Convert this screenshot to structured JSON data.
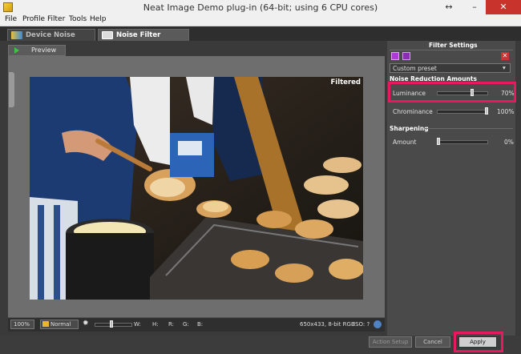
{
  "window": {
    "title": "Neat Image Demo plug-in (64-bit; using 6 CPU cores)",
    "resize_glyph": "↔",
    "minimize": "–",
    "maximize": "□",
    "close": "✕"
  },
  "menu": [
    "File",
    "Profile",
    "Filter",
    "Tools",
    "Help"
  ],
  "tabs": [
    {
      "label": "Device Noise Profile",
      "active": false
    },
    {
      "label": "Noise Filter Settings",
      "active": true
    }
  ],
  "preview": {
    "tab_label": "Preview",
    "overlay_label": "Filtered"
  },
  "status_bar": {
    "zoom": "100%",
    "mode": "Normal",
    "w_label": "W:",
    "h_label": "H:",
    "r_label": "R:",
    "g_label": "G:",
    "b_label": "B:",
    "image_info": "650x433, 8-bit RGB",
    "iso": "ISO: ?"
  },
  "filter_settings": {
    "title": "Filter Settings",
    "preset": "Custom preset",
    "noise_reduction_title": "Noise Reduction Amounts",
    "luminance": {
      "label": "Luminance",
      "value_text": "70%",
      "value": 70
    },
    "chrominance": {
      "label": "Chrominance",
      "value_text": "100%",
      "value": 100
    },
    "sharpening_title": "Sharpening",
    "amount": {
      "label": "Amount",
      "value_text": "0%",
      "value": 0
    }
  },
  "footer": {
    "action_setup": "Action Setup",
    "cancel": "Cancel",
    "apply": "Apply"
  },
  "colors": {
    "highlight": "#e8195e",
    "accent_purple": "#b03ad8"
  }
}
